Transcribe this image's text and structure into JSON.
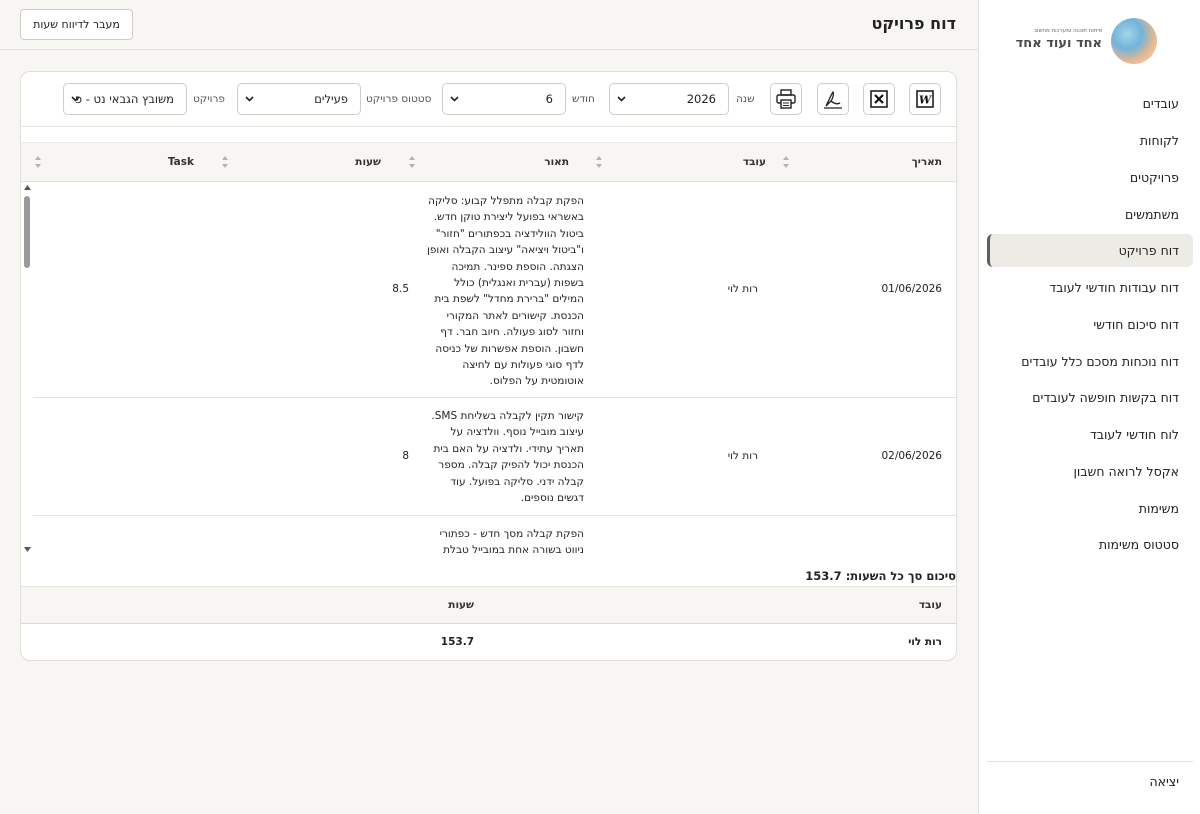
{
  "sidebar": {
    "logo": {
      "main": "אחד ועוד אחד",
      "sub": "פיתוח תוכנה ומערכות מחשוב"
    },
    "items": [
      {
        "label": "עובדים"
      },
      {
        "label": "לקוחות"
      },
      {
        "label": "פרויקטים"
      },
      {
        "label": "משתמשים"
      },
      {
        "label": "דוח פרויקט",
        "active": true
      },
      {
        "label": "דוח עבודות חודשי לעובד"
      },
      {
        "label": "דוח סיכום חודשי"
      },
      {
        "label": "דוח נוכחות מסכם כלל עובדים"
      },
      {
        "label": "דוח בקשות חופשה לעובדים"
      },
      {
        "label": "לוח חודשי לעובד"
      },
      {
        "label": "אקסל לרואה חשבון"
      },
      {
        "label": "משימות"
      },
      {
        "label": "סטטוס משימות"
      }
    ],
    "logout": "יציאה"
  },
  "header": {
    "title": "דוח פרויקט",
    "goto_button": "מעבר לדיווח שעות"
  },
  "filters": {
    "year_label": "שנה",
    "year_value": "2026",
    "month_label": "חודש",
    "month_value": "6",
    "status_label": "סטטוס פרויקט",
    "status_value": "פעילים",
    "project_label": "פרויקט",
    "project_value": "משובץ הגבאי נט - פ",
    "icons": [
      "word-icon",
      "excel-icon",
      "pdf-icon",
      "print-icon"
    ]
  },
  "table": {
    "columns": [
      "תאריך",
      "עובד",
      "תאור",
      "שעות",
      "Task"
    ],
    "rows": [
      {
        "date": "01/06/2026",
        "employee": "רות לוי",
        "hours": "8.5",
        "task": "",
        "description": [
          "הפקת קבלה מתפלל קבוע: סליקה",
          "באשראי בפועל ליצירת טוקן חדש.",
          "ביטול הוולידציה בכפתורים \"חזור\"",
          "ו\"ביטול ויציאה\" עיצוב הקבלה ואופן",
          "הצגתה. הוספת ספינר. תמיכה",
          "בשפות (עברית ואנגלית) כולל",
          "המילים \"ברירת מחדל\" לשפת בית",
          "הכנסת. קישורים לאתר המקורי",
          "וחזור לסוג פעולה. חיוב חבר. דף",
          "חשבון. הוספת אפשרות של כניסה",
          "לדף סוגי פעולות עם לחיצה",
          "אוטומטית על הפלוס."
        ]
      },
      {
        "date": "02/06/2026",
        "employee": "רות לוי",
        "hours": "8",
        "task": "",
        "description": [
          "קישור תקין לקבלה בשליחת SMS.",
          "עיצוב מובייל נוסף. וולדציה על",
          "תאריך עתידי. ולדציה על האם בית",
          "הכנסת יכול להפיק קבלה. מספר",
          "קבלה ידני. סליקה בפועל. עוד",
          "דגשים נוספים."
        ]
      },
      {
        "date": "",
        "employee": "",
        "hours": "",
        "task": "",
        "description": [
          "הפקת קבלה מסך חדש - כפתורי",
          "ניווט בשורה אחת במובייל טבלת"
        ]
      }
    ]
  },
  "summary": {
    "title": "סיכום סך כל השעות: 153.7",
    "columns": [
      "עובד",
      "שעות"
    ],
    "rows": [
      {
        "employee": "רות לוי",
        "hours": "153.7"
      }
    ]
  },
  "colors": {
    "background": "#f7f6f3",
    "card": "#ffffff",
    "active_item": "#ecebe6",
    "border": "#e0ded8"
  }
}
